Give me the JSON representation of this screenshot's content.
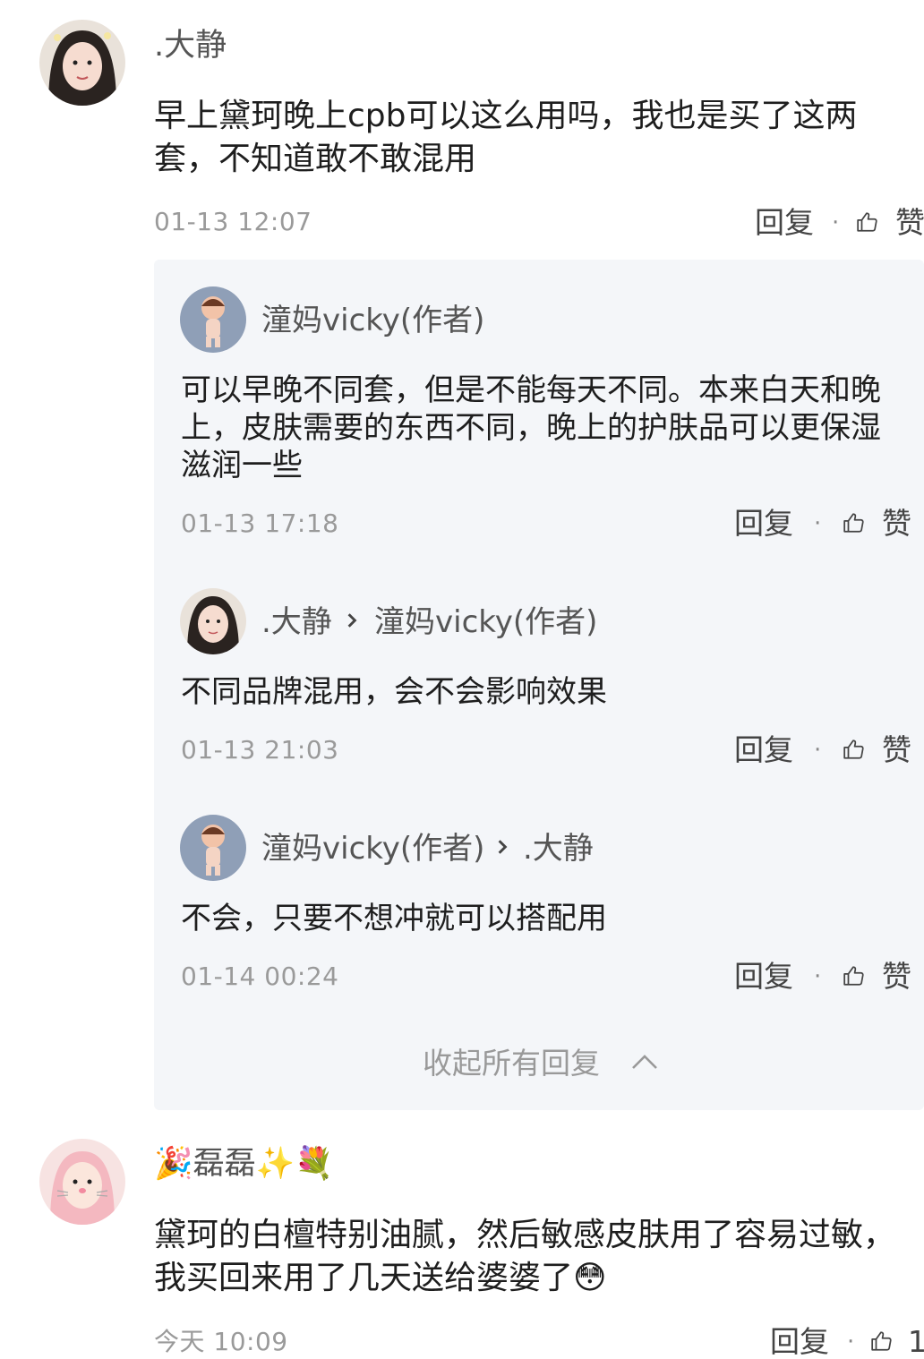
{
  "comments": [
    {
      "user": ".大静",
      "text": "早上黛珂晚上cpb可以这么用吗，我也是买了这两套，不知道敢不敢混用",
      "time": "01-13 12:07",
      "reply_label": "回复",
      "like_label": "赞",
      "replies": [
        {
          "user": "潼妈vicky(作者)",
          "text": "可以早晚不同套，但是不能每天不同。本来白天和晚上，皮肤需要的东西不同，晚上的护肤品可以更保湿滋润一些",
          "time": "01-13 17:18",
          "reply_label": "回复",
          "like_label": "赞"
        },
        {
          "user": ".大静",
          "to_user": "潼妈vicky(作者)",
          "text": "不同品牌混用，会不会影响效果",
          "time": "01-13 21:03",
          "reply_label": "回复",
          "like_label": "赞"
        },
        {
          "user": "潼妈vicky(作者)",
          "to_user": ".大静",
          "text": "不会，只要不想冲就可以搭配用",
          "time": "01-14 00:24",
          "reply_label": "回复",
          "like_label": "赞"
        }
      ],
      "collapse_label": "收起所有回复"
    },
    {
      "user_prefix_emoji": "🎉",
      "user": "磊磊",
      "user_suffix_emoji": "✨💐",
      "text": "黛珂的白檀特别油腻，然后敏感皮肤用了容易过敏，我买回来用了几天送给婆婆了😳",
      "time": "今天 10:09",
      "reply_label": "回复",
      "like_count": "1"
    }
  ],
  "separator": "·",
  "icons": {
    "like": "thumbs-up-icon",
    "reply_arrow": "chevron-right-icon",
    "collapse": "chevron-up-icon"
  },
  "colors": {
    "panel_bg": "#f4f6f9",
    "username": "#555555",
    "timestamp": "#9a9a9a"
  }
}
